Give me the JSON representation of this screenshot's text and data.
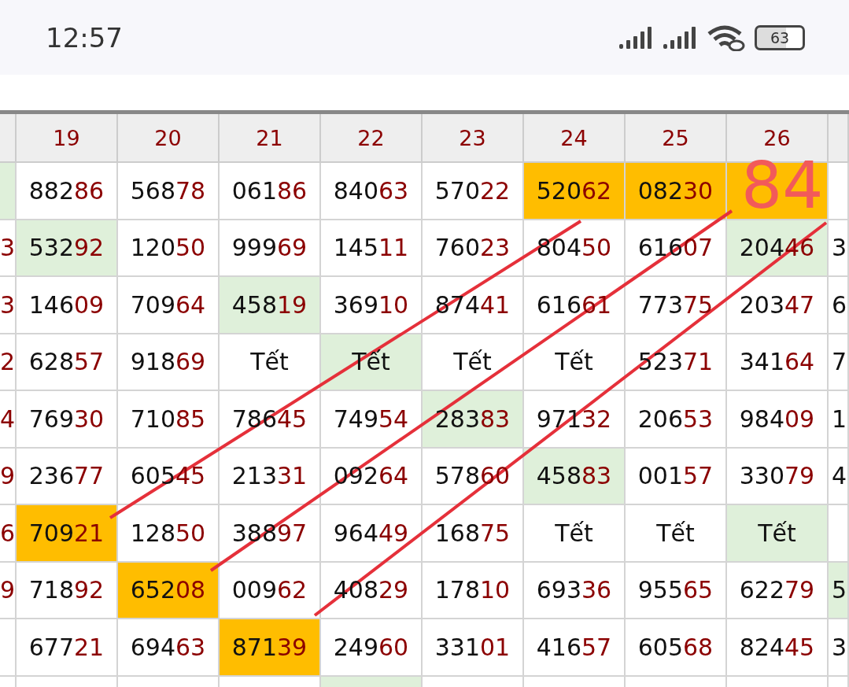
{
  "status_bar": {
    "time": "12:57",
    "battery": "63"
  },
  "table": {
    "columns": [
      {},
      {
        "label": "19"
      },
      {
        "label": "20"
      },
      {
        "label": "21"
      },
      {
        "label": "22"
      },
      {
        "label": "23"
      },
      {
        "label": "24"
      },
      {
        "label": "25"
      },
      {
        "label": "26"
      },
      {}
    ],
    "rows": [
      [
        {
          "color": "#dff0da"
        },
        {
          "lead": "882",
          "tail": "86"
        },
        {
          "lead": "568",
          "tail": "78"
        },
        {
          "lead": "061",
          "tail": "86"
        },
        {
          "lead": "840",
          "tail": "63"
        },
        {
          "lead": "570",
          "tail": "22"
        },
        {
          "lead": "520",
          "tail": "62",
          "color": "#ffbd00"
        },
        {
          "lead": "082",
          "tail": "30",
          "color": "#ffbd00"
        },
        {
          "color": "#ffbd00",
          "overlay": "84"
        },
        {}
      ],
      [
        {
          "tail": "3"
        },
        {
          "lead": "532",
          "tail": "92",
          "color": "#dff0da"
        },
        {
          "lead": "120",
          "tail": "50"
        },
        {
          "lead": "999",
          "tail": "69"
        },
        {
          "lead": "145",
          "tail": "11"
        },
        {
          "lead": "760",
          "tail": "23"
        },
        {
          "lead": "804",
          "tail": "50"
        },
        {
          "lead": "616",
          "tail": "07"
        },
        {
          "lead": "204",
          "tail": "46",
          "color": "#dff0da"
        },
        {
          "lead": "3"
        }
      ],
      [
        {
          "tail": "3"
        },
        {
          "lead": "146",
          "tail": "09"
        },
        {
          "lead": "709",
          "tail": "64"
        },
        {
          "lead": "458",
          "tail": "19",
          "color": "#dff0da"
        },
        {
          "lead": "369",
          "tail": "10"
        },
        {
          "lead": "874",
          "tail": "41"
        },
        {
          "lead": "616",
          "tail": "61"
        },
        {
          "lead": "773",
          "tail": "75"
        },
        {
          "lead": "203",
          "tail": "47"
        },
        {
          "lead": "6"
        }
      ],
      [
        {
          "tail": "2"
        },
        {
          "lead": "628",
          "tail": "57"
        },
        {
          "lead": "918",
          "tail": "69"
        },
        {
          "lead": "Tết"
        },
        {
          "lead": "Tết",
          "color": "#dff0da"
        },
        {
          "lead": "Tết"
        },
        {
          "lead": "Tết"
        },
        {
          "lead": "523",
          "tail": "71"
        },
        {
          "lead": "341",
          "tail": "64"
        },
        {
          "lead": "7"
        }
      ],
      [
        {
          "tail": "4"
        },
        {
          "lead": "769",
          "tail": "30"
        },
        {
          "lead": "710",
          "tail": "85"
        },
        {
          "lead": "786",
          "tail": "45"
        },
        {
          "lead": "749",
          "tail": "54"
        },
        {
          "lead": "283",
          "tail": "83",
          "color": "#dff0da"
        },
        {
          "lead": "971",
          "tail": "32"
        },
        {
          "lead": "206",
          "tail": "53"
        },
        {
          "lead": "984",
          "tail": "09"
        },
        {
          "lead": "1"
        }
      ],
      [
        {
          "tail": "9"
        },
        {
          "lead": "236",
          "tail": "77"
        },
        {
          "lead": "605",
          "tail": "45"
        },
        {
          "lead": "213",
          "tail": "31"
        },
        {
          "lead": "092",
          "tail": "64"
        },
        {
          "lead": "578",
          "tail": "60"
        },
        {
          "lead": "458",
          "tail": "83",
          "color": "#dff0da"
        },
        {
          "lead": "001",
          "tail": "57"
        },
        {
          "lead": "330",
          "tail": "79"
        },
        {
          "lead": "4"
        }
      ],
      [
        {
          "tail": "6"
        },
        {
          "lead": "709",
          "tail": "21",
          "color": "#ffbd00"
        },
        {
          "lead": "128",
          "tail": "50"
        },
        {
          "lead": "388",
          "tail": "97"
        },
        {
          "lead": "964",
          "tail": "49"
        },
        {
          "lead": "168",
          "tail": "75"
        },
        {
          "lead": "Tết"
        },
        {
          "lead": "Tết"
        },
        {
          "lead": "Tết",
          "color": "#dff0da"
        },
        {}
      ],
      [
        {
          "tail": "9"
        },
        {
          "lead": "718",
          "tail": "92"
        },
        {
          "lead": "652",
          "tail": "08",
          "color": "#ffbd00"
        },
        {
          "lead": "009",
          "tail": "62"
        },
        {
          "lead": "408",
          "tail": "29"
        },
        {
          "lead": "178",
          "tail": "10"
        },
        {
          "lead": "693",
          "tail": "36"
        },
        {
          "lead": "955",
          "tail": "65"
        },
        {
          "lead": "622",
          "tail": "79"
        },
        {
          "lead": "5",
          "color": "#dff0da"
        }
      ],
      [
        {},
        {
          "lead": "677",
          "tail": "21"
        },
        {
          "lead": "694",
          "tail": "63"
        },
        {
          "lead": "871",
          "tail": "39",
          "color": "#ffbd00"
        },
        {
          "lead": "249",
          "tail": "60"
        },
        {
          "lead": "331",
          "tail": "01"
        },
        {
          "lead": "416",
          "tail": "57"
        },
        {
          "lead": "605",
          "tail": "68"
        },
        {
          "lead": "824",
          "tail": "45"
        },
        {
          "lead": "3"
        }
      ],
      [
        {},
        {},
        {},
        {},
        {
          "color": "#dff0da"
        },
        {},
        {},
        {},
        {},
        {}
      ]
    ]
  }
}
